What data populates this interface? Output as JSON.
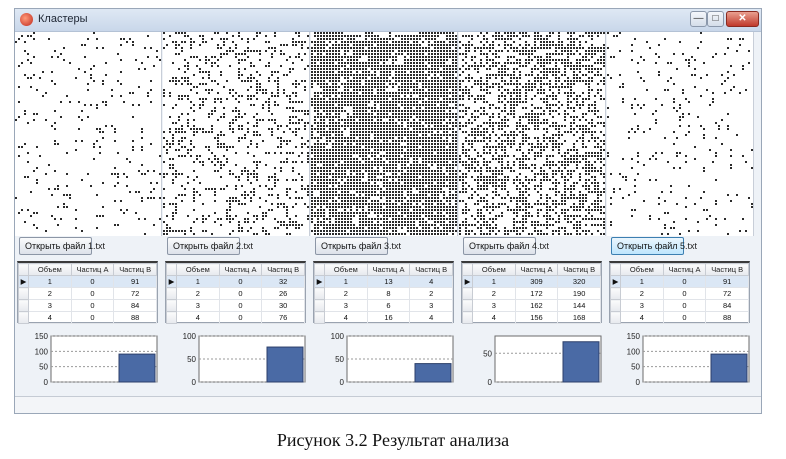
{
  "window": {
    "title": "Кластеры",
    "min_label": "—",
    "max_label": "□",
    "close_label": "✕"
  },
  "open_button_label": "Открыть файл",
  "table_headers": [
    "Объем",
    "Частиц А",
    "Частиц В"
  ],
  "panels": [
    {
      "file": "1.txt",
      "density": 0.07,
      "cluster": 0.0,
      "rows": [
        [
          "1",
          "0",
          "91"
        ],
        [
          "2",
          "0",
          "72"
        ],
        [
          "3",
          "0",
          "84"
        ],
        [
          "4",
          "0",
          "88"
        ]
      ],
      "chart": {
        "ticks": [
          "150",
          "100",
          "50",
          "0"
        ],
        "ymax": 150,
        "value": 91
      }
    },
    {
      "file": "2.txt",
      "density": 0.25,
      "cluster": 0.2,
      "rows": [
        [
          "1",
          "0",
          "32"
        ],
        [
          "2",
          "0",
          "26"
        ],
        [
          "3",
          "0",
          "30"
        ],
        [
          "4",
          "0",
          "76"
        ]
      ],
      "chart": {
        "ticks": [
          "100",
          "50",
          "0"
        ],
        "ymax": 100,
        "value": 76
      }
    },
    {
      "file": "3.txt",
      "density": 0.55,
      "cluster": 0.75,
      "rows": [
        [
          "1",
          "13",
          "4"
        ],
        [
          "2",
          "8",
          "2"
        ],
        [
          "3",
          "6",
          "3"
        ],
        [
          "4",
          "16",
          "4"
        ]
      ],
      "chart": {
        "ticks": [
          "100",
          "50",
          "0"
        ],
        "ymax": 100,
        "value": 40
      }
    },
    {
      "file": "4.txt",
      "density": 0.5,
      "cluster": 0.1,
      "rows": [
        [
          "1",
          "309",
          "320"
        ],
        [
          "2",
          "172",
          "190"
        ],
        [
          "3",
          "162",
          "144"
        ],
        [
          "4",
          "156",
          "168"
        ]
      ],
      "chart": {
        "ticks": [
          "50",
          "0"
        ],
        "ymax": 80,
        "value": 70
      }
    },
    {
      "file": "5.txt",
      "density": 0.07,
      "cluster": 0.0,
      "rows": [
        [
          "1",
          "0",
          "91"
        ],
        [
          "2",
          "0",
          "72"
        ],
        [
          "3",
          "0",
          "84"
        ],
        [
          "4",
          "0",
          "88"
        ]
      ],
      "chart": {
        "ticks": [
          "150",
          "100",
          "50",
          "0"
        ],
        "ymax": 150,
        "value": 91
      }
    }
  ],
  "caption": "Рисунок 3.2 Результат анализа",
  "colors": {
    "bar": "#4a6aa5",
    "bar_edge": "#2c3f6a",
    "cell": "#2b2b2b"
  }
}
